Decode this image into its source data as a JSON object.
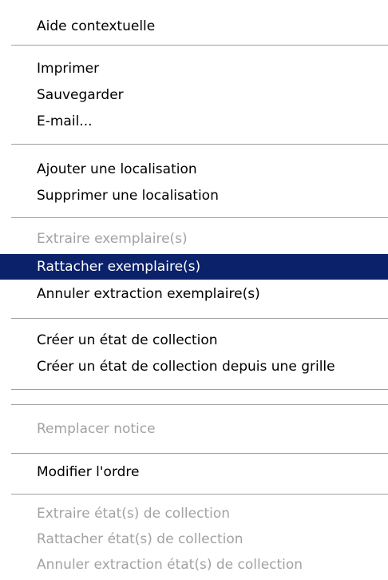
{
  "menu": {
    "colors": {
      "highlight_bg": "#0b226b",
      "highlight_text": "#ffffff",
      "disabled_text": "#a2a2a2"
    },
    "items": [
      {
        "label": "Aide contextuelle",
        "disabled": false,
        "highlighted": false
      },
      {
        "label": "Imprimer",
        "disabled": false,
        "highlighted": false
      },
      {
        "label": "Sauvegarder",
        "disabled": false,
        "highlighted": false
      },
      {
        "label": "E-mail...",
        "disabled": false,
        "highlighted": false
      },
      {
        "label": "Ajouter une localisation",
        "disabled": false,
        "highlighted": false
      },
      {
        "label": "Supprimer une localisation",
        "disabled": false,
        "highlighted": false
      },
      {
        "label": "Extraire exemplaire(s)",
        "disabled": true,
        "highlighted": false
      },
      {
        "label": "Rattacher exemplaire(s)",
        "disabled": false,
        "highlighted": true
      },
      {
        "label": "Annuler extraction exemplaire(s)",
        "disabled": false,
        "highlighted": false
      },
      {
        "label": "Créer un état de collection",
        "disabled": false,
        "highlighted": false
      },
      {
        "label": "Créer un état de collection depuis une grille",
        "disabled": false,
        "highlighted": false
      },
      {
        "label": "Remplacer notice",
        "disabled": true,
        "highlighted": false
      },
      {
        "label": "Modifier l'ordre",
        "disabled": false,
        "highlighted": false
      },
      {
        "label": "Extraire état(s) de collection",
        "disabled": true,
        "highlighted": false
      },
      {
        "label": "Rattacher état(s) de collection",
        "disabled": true,
        "highlighted": false
      },
      {
        "label": "Annuler extraction état(s) de collection",
        "disabled": true,
        "highlighted": false
      }
    ]
  }
}
